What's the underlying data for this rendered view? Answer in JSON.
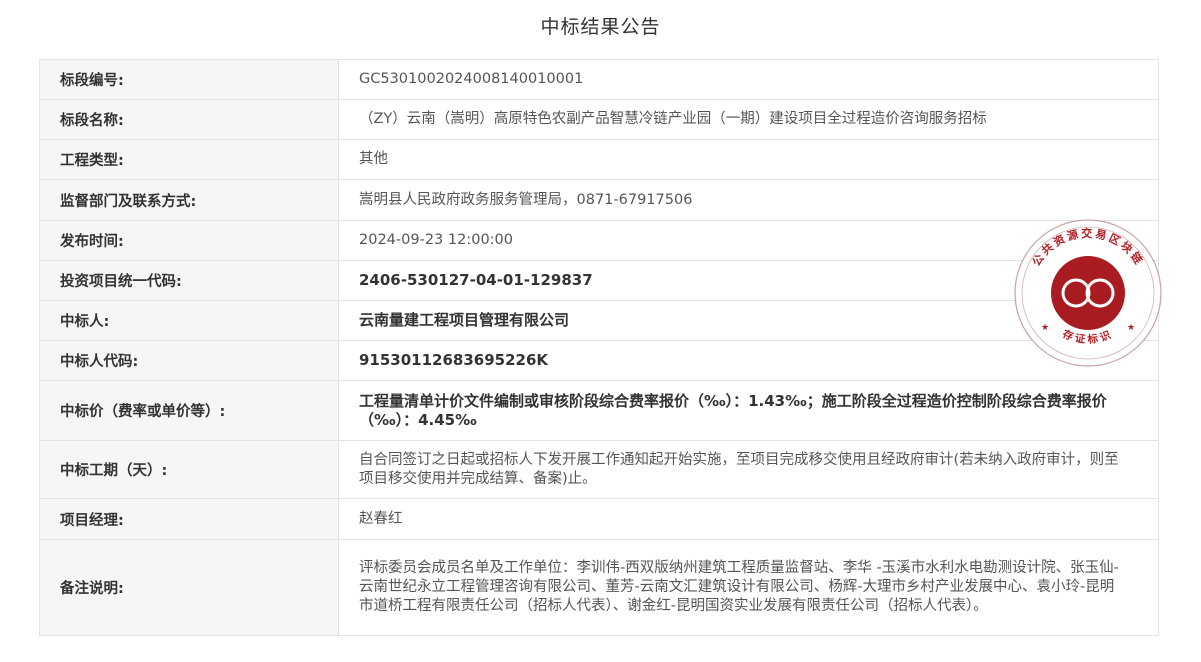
{
  "page": {
    "title": "中标结果公告"
  },
  "rows": [
    {
      "label": "标段编号:",
      "value": "GC5301002024008140010001",
      "bold": false
    },
    {
      "label": "标段名称:",
      "value": "（ZY）云南（嵩明）高原特色农副产品智慧冷链产业园（一期）建设项目全过程造价咨询服务招标",
      "bold": false
    },
    {
      "label": "工程类型:",
      "value": "其他",
      "bold": false
    },
    {
      "label": "监督部门及联系方式:",
      "value": "嵩明县人民政府政务服务管理局，0871-67917506",
      "bold": false
    },
    {
      "label": "发布时间:",
      "value": "2024-09-23 12:00:00",
      "bold": false
    },
    {
      "label": "投资项目统一代码:",
      "value": "2406-530127-04-01-129837",
      "bold": true
    },
    {
      "label": "中标人:",
      "value": "云南量建工程项目管理有限公司",
      "bold": true
    },
    {
      "label": "中标人代码:",
      "value": "91530112683695226K",
      "bold": true
    },
    {
      "label": "中标价（费率或单价等）:",
      "value": "工程量清单计价文件编制或审核阶段综合费率报价（‰）：1.43‰；施工阶段全过程造价控制阶段综合费率报价（‰）：4.45‰",
      "bold": true
    },
    {
      "label": "中标工期（天）:",
      "value": "自合同签订之日起或招标人下发开展工作通知起开始实施，至项目完成移交使用且经政府审计(若未纳入政府审计，则至项目移交使用并完成结算、备案)止。",
      "bold": false
    },
    {
      "label": "项目经理:",
      "value": "赵春红",
      "bold": false
    },
    {
      "label": "备注说明:",
      "value": "评标委员会成员名单及工作单位：李训伟-西双版纳州建筑工程质量监督站、李华 -玉溪市水利水电勘测设计院、张玉仙-云南世纪永立工程管理咨询有限公司、董芳-云南文汇建筑设计有限公司、杨辉-大理市乡村产业发展中心、袁小玲-昆明市道桥工程有限责任公司（招标人代表）、谢金红-昆明国资实业发展有限责任公司（招标人代表）。",
      "bold": false
    }
  ],
  "stamp": {
    "top_text": "公共资源交易区块链",
    "bottom_text": "存证标识",
    "color": "#b11f24",
    "inner_color": "#a81c21"
  }
}
